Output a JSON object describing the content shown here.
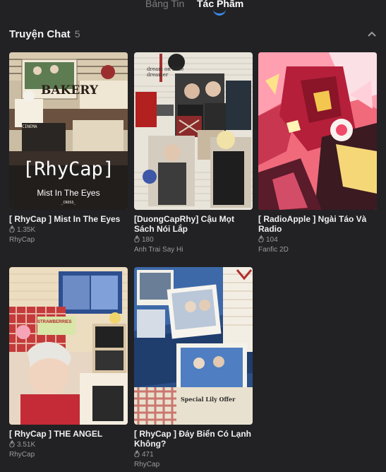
{
  "tabs": {
    "inactive": "Bảng Tin",
    "active": "Tác Phẩm"
  },
  "section": {
    "title": "Truyện Chat",
    "count": "5"
  },
  "colors": {
    "background": "#222224",
    "accent": "#3b8cf0"
  },
  "stories": [
    {
      "title": "[ RhyCap ] Mist In The Eyes",
      "views": "1.35K",
      "author": "RhyCap",
      "cover_text": {
        "main": "[RhyCap]",
        "sub": "Mist In The Eyes",
        "tag": "_CROSS_",
        "shop": "BAKERY",
        "cinema": "CINEMA"
      }
    },
    {
      "title": "[DuongCapRhy] Cậu Mọt Sách Nói Lắp",
      "views": "180",
      "author": "Anh Trai Say Hi",
      "cover_text": {
        "note": "dream on little dreamer"
      }
    },
    {
      "title": "[ RadioApple ] Ngài Táo Và Radio",
      "views": "104",
      "author": "Fanfic 2D"
    },
    {
      "title": "[ RhyCap ] THE ANGEL",
      "views": "3.51K",
      "author": "RhyCap",
      "cover_text": {
        "label": "STRAWBERRIES"
      }
    },
    {
      "title": "[ RhyCap ] Đáy Biển Có Lạnh Không?",
      "views": "471",
      "author": "RhyCap",
      "cover_text": {
        "label": "Special Lily Offer"
      }
    }
  ]
}
